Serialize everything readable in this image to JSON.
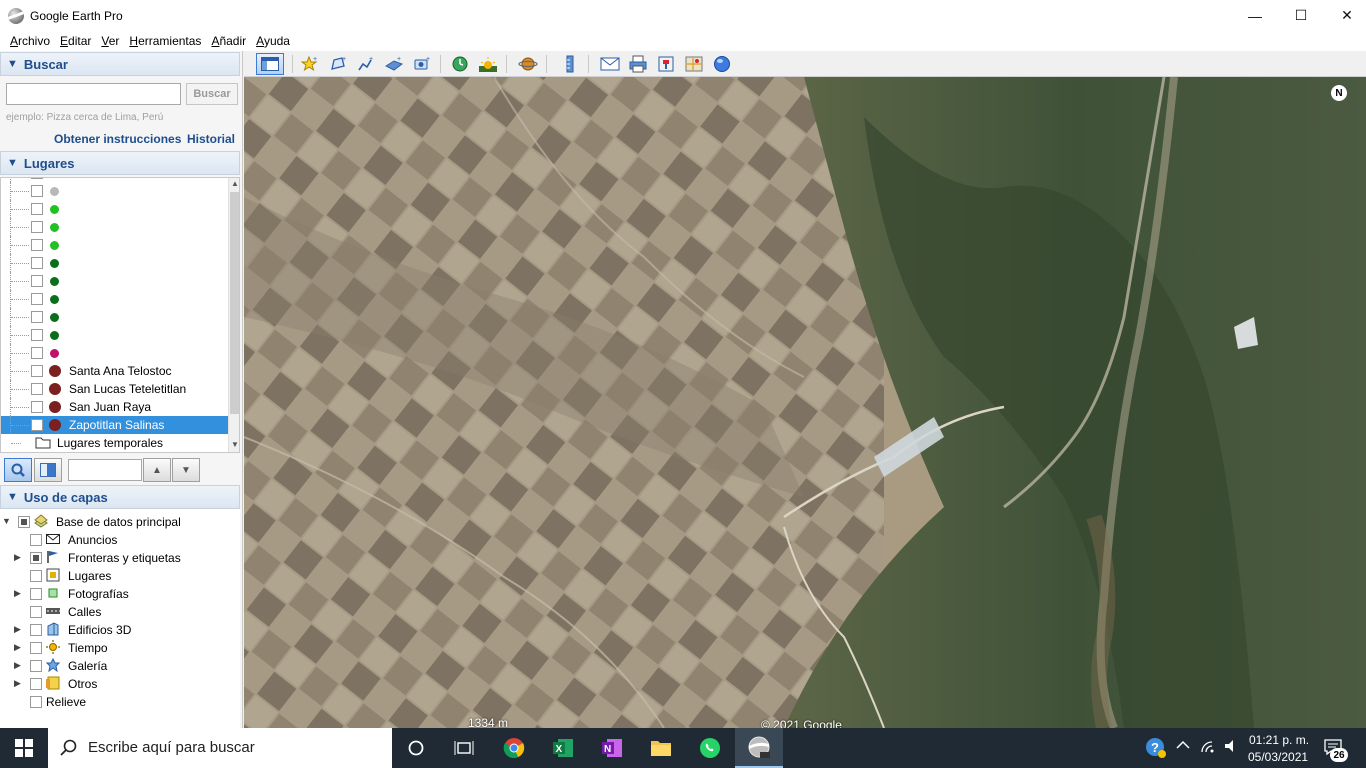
{
  "window": {
    "title": "Google Earth Pro",
    "minimize": "—",
    "maximize": "☐",
    "close": "✕"
  },
  "menu": {
    "items": [
      {
        "label_u": "A",
        "label_rest": "rchivo"
      },
      {
        "label_u": "E",
        "label_rest": "ditar"
      },
      {
        "label_u": "V",
        "label_rest": "er"
      },
      {
        "label_u": "H",
        "label_rest": "erramientas"
      },
      {
        "label_u": "A",
        "label_rest": "ñadir"
      },
      {
        "label_u": "A",
        "label_rest": "yuda"
      }
    ]
  },
  "search": {
    "header": "Buscar",
    "input_value": "",
    "button_label": "Buscar",
    "hint": "ejemplo: Pizza cerca de Lima, Perú",
    "directions_link": "Obtener instrucciones",
    "history_link": "Historial"
  },
  "places": {
    "header": "Lugares",
    "items": [
      {
        "label": "",
        "color": "#b8b8b8"
      },
      {
        "label": "",
        "color": "#b8b8b8"
      },
      {
        "label": "",
        "color": "#22c022"
      },
      {
        "label": "",
        "color": "#22c022"
      },
      {
        "label": "",
        "color": "#22c022"
      },
      {
        "label": "",
        "color": "#0a6e1a"
      },
      {
        "label": "",
        "color": "#0a6e1a"
      },
      {
        "label": "",
        "color": "#0a6e1a"
      },
      {
        "label": "",
        "color": "#0a6e1a"
      },
      {
        "label": "",
        "color": "#0a6e1a"
      },
      {
        "label": "",
        "color": "#c0106a"
      },
      {
        "label": "Santa Ana Telostoc",
        "color": "#7a2020"
      },
      {
        "label": "San Lucas Teteletitlan",
        "color": "#7a2020"
      },
      {
        "label": "San Juan Raya",
        "color": "#7a2020"
      },
      {
        "label": "Zapotitlan Salinas",
        "color": "#7a2020",
        "selected": true
      }
    ],
    "temp_folder": "Lugares temporales"
  },
  "layers": {
    "header": "Uso de capas",
    "items": [
      {
        "label": "Base de datos principal",
        "icon": "database-icon"
      },
      {
        "label": "Anuncios",
        "icon": "mail-icon"
      },
      {
        "label": "Fronteras y etiquetas",
        "icon": "flag-icon"
      },
      {
        "label": "Lugares",
        "icon": "places-icon"
      },
      {
        "label": "Fotografías",
        "icon": "photo-icon"
      },
      {
        "label": "Calles",
        "icon": "road-icon"
      },
      {
        "label": "Edificios 3D",
        "icon": "building-icon"
      },
      {
        "label": "Tiempo",
        "icon": "sun-icon"
      },
      {
        "label": "Galería",
        "icon": "star-icon"
      },
      {
        "label": "Otros",
        "icon": "folder-icon"
      },
      {
        "label": "Relieve",
        "icon": ""
      }
    ]
  },
  "map": {
    "compass": "N",
    "scale": "1334 m",
    "copyright": "© 2021 Google"
  },
  "taskbar": {
    "search_placeholder": "Escribe aquí para buscar",
    "time": "01:21 p. m.",
    "date": "05/03/2021",
    "notifications": "26"
  }
}
